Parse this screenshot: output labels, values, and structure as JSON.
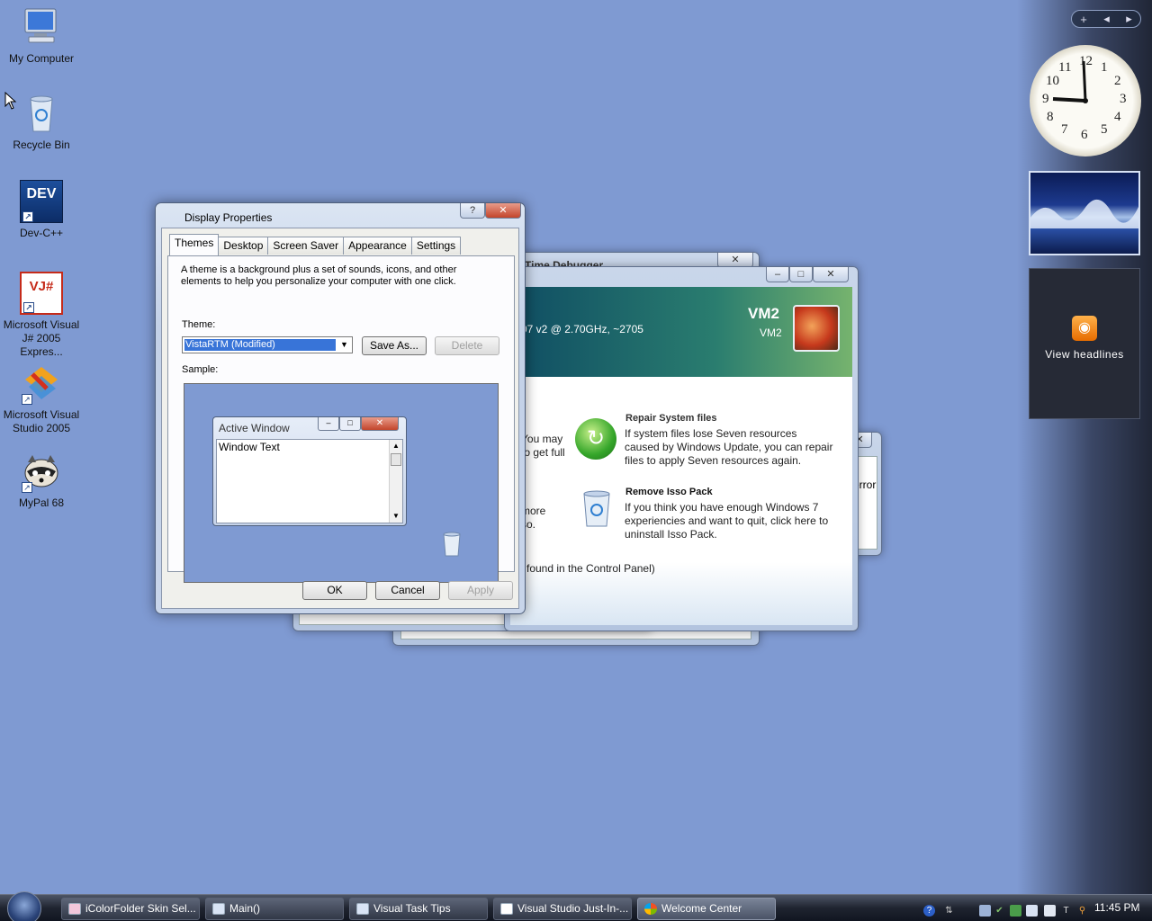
{
  "desktop": {
    "icons": [
      {
        "label": "My Computer",
        "icon": "computer-icon"
      },
      {
        "label": "Recycle Bin",
        "icon": "recycle-bin-icon"
      },
      {
        "label": "Dev-C++",
        "icon": "devcpp-icon",
        "badge": "DEV"
      },
      {
        "label": "Microsoft Visual J# 2005 Expres...",
        "icon": "vjsharp-icon",
        "badge": "VJ#"
      },
      {
        "label": "Microsoft Visual Studio 2005",
        "icon": "visual-studio-icon"
      },
      {
        "label": "MyPal 68",
        "icon": "raccoon-icon"
      }
    ]
  },
  "sidebar": {
    "add_glyph": "+",
    "prev_glyph": "◂",
    "next_glyph": "▸",
    "clock": {
      "time_shown": "9:00",
      "numerals": [
        "12",
        "1",
        "2",
        "3",
        "4",
        "5",
        "6",
        "7",
        "8",
        "9",
        "10",
        "11"
      ]
    },
    "feed_label": "View headlines"
  },
  "background_windows": {
    "debugger_title": "Visual Studio Just-In-Time Debugger",
    "debugger_title_visible": "Time Debugger",
    "welcome": {
      "header_title": "VM2",
      "header_subtitle": "VM2",
      "cpu_text": "07 v2 @ 2.70GHz, ~2705",
      "left_text_1a": "You may",
      "left_text_1b": "to get full",
      "left_text_2a": "more",
      "left_text_2b": "so.",
      "repair_title": "Repair System files",
      "repair_desc": "If system files lose Seven resources caused by Windows Update, you can repair files to apply Seven resources again.",
      "remove_title": "Remove Isso Pack",
      "remove_desc": "If you think you have enough Windows 7 experiencies and want to quit, click here to uninstall Isso Pack.",
      "footer_text": "found in the Control Panel)"
    },
    "error_fragment": "error"
  },
  "dialog": {
    "title": "Display Properties",
    "help_glyph": "?",
    "close_glyph": "✕",
    "tabs": [
      "Themes",
      "Desktop",
      "Screen Saver",
      "Appearance",
      "Settings"
    ],
    "description": "A theme is a background plus a set of sounds, icons, and other elements to help you personalize your computer with one click.",
    "theme_label": "Theme:",
    "theme_value": "VistaRTM (Modified)",
    "save_as": "Save As...",
    "delete": "Delete",
    "sample_label": "Sample:",
    "sample_window_title": "Active Window",
    "sample_window_text": "Window Text",
    "ok": "OK",
    "cancel": "Cancel",
    "apply": "Apply"
  },
  "taskbar": {
    "buttons": [
      {
        "label": "iColorFolder Skin Sel..."
      },
      {
        "label": "Main()"
      },
      {
        "label": "Visual Task Tips"
      },
      {
        "label": "Visual Studio Just-In-..."
      },
      {
        "label": "Welcome Center"
      }
    ],
    "clock": "11:45 PM"
  },
  "colors": {
    "desktop": "#7f9ad2",
    "selection": "#3874d8",
    "close_button": "#c3452b"
  }
}
